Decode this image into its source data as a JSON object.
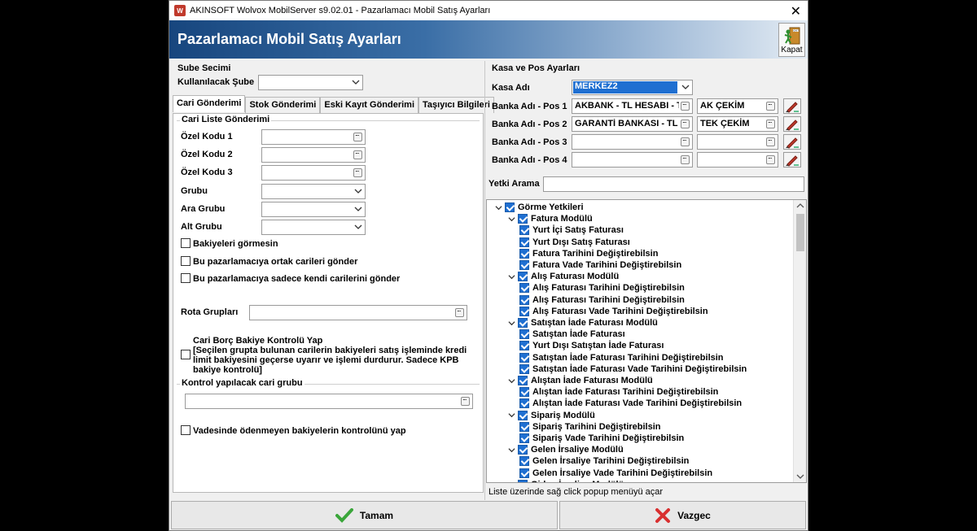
{
  "window": {
    "title": "AKINSOFT Wolvox MobilServer s9.02.01 - Pazarlamacı Mobil Satış Ayarları",
    "banner_title": "Pazarlamacı Mobil Satış Ayarları",
    "close_label": "Kapat",
    "app_icon_text": "W"
  },
  "branch": {
    "section_title": "Sube Secimi",
    "label": "Kullanılacak Şube",
    "value": ""
  },
  "tabs": [
    {
      "label": "Cari Gönderimi",
      "active": true
    },
    {
      "label": "Stok Gönderimi",
      "active": false
    },
    {
      "label": "Eski Kayıt Gönderimi",
      "active": false
    },
    {
      "label": "Taşıyıcı Bilgileri",
      "active": false
    }
  ],
  "cari": {
    "group_title": "Cari Liste Gönderimi",
    "fields": [
      {
        "label": "Özel Kodu 1",
        "value": ""
      },
      {
        "label": "Özel Kodu 2",
        "value": ""
      },
      {
        "label": "Özel Kodu 3",
        "value": ""
      },
      {
        "label": "Grubu",
        "value": ""
      },
      {
        "label": "Ara Grubu",
        "value": ""
      },
      {
        "label": "Alt Grubu",
        "value": ""
      }
    ],
    "checks": [
      {
        "label": "Bakiyeleri görmesin",
        "checked": false
      },
      {
        "label": "Bu pazarlamacıya ortak carileri gönder",
        "checked": false
      },
      {
        "label": "Bu pazarlamacıya sadece kendi carilerini gönder",
        "checked": false
      }
    ],
    "rota_label": "Rota Grupları",
    "rota_value": "",
    "borc_check_title": "Cari Borç Bakiye Kontrolü Yap",
    "borc_check_desc1": "[Seçilen grupta bulunan carilerin bakiyeleri satış işleminde kredi",
    "borc_check_desc2": "limit bakiyesini geçerse uyarır ve işlemi durdurur. Sadece KPB",
    "borc_check_desc3": "bakiye kontrolü]",
    "kontrol_group_title": "Kontrol yapılacak cari grubu",
    "kontrol_value": "",
    "vade_check": "Vadesinde ödenmeyen bakiyelerin kontrolünü yap"
  },
  "kasa": {
    "section_title": "Kasa ve Pos Ayarları",
    "kasa_label": "Kasa Adı",
    "kasa_value": "MERKEZ2",
    "pos": [
      {
        "label": "Banka Adı - Pos 1",
        "bank": "AKBANK - TL HESABI - T",
        "type": "AK ÇEKİM"
      },
      {
        "label": "Banka Adı - Pos 2",
        "bank": "GARANTİ BANKASI - TL",
        "type": "TEK ÇEKİM"
      },
      {
        "label": "Banka Adı - Pos 3",
        "bank": "",
        "type": ""
      },
      {
        "label": "Banka Adı - Pos 4",
        "bank": "",
        "type": ""
      }
    ],
    "yetki_label": "Yetki Arama",
    "yetki_value": ""
  },
  "tree": [
    {
      "level": 0,
      "label": "Görme Yetkileri",
      "expanded": true
    },
    {
      "level": 1,
      "label": "Fatura Modülü",
      "expanded": true
    },
    {
      "level": 2,
      "label": "Yurt İçi Satış Faturası"
    },
    {
      "level": 2,
      "label": "Yurt Dışı Satış Faturası"
    },
    {
      "level": 2,
      "label": "Fatura Tarihini Değiştirebilsin"
    },
    {
      "level": 2,
      "label": "Fatura Vade Tarihini Değiştirebilsin"
    },
    {
      "level": 1,
      "label": "Alış Faturası Modülü",
      "expanded": true
    },
    {
      "level": 2,
      "label": "Alış Faturası Tarihini Değiştirebilsin"
    },
    {
      "level": 2,
      "label": "Alış Faturası Tarihini Değiştirebilsin"
    },
    {
      "level": 2,
      "label": "Alış Faturası Vade Tarihini Değiştirebilsin"
    },
    {
      "level": 1,
      "label": "Satıştan İade Faturası Modülü",
      "expanded": true
    },
    {
      "level": 2,
      "label": "Satıştan İade Faturası"
    },
    {
      "level": 2,
      "label": "Yurt Dışı Satıştan İade Faturası"
    },
    {
      "level": 2,
      "label": "Satıştan İade Faturası Tarihini Değiştirebilsin"
    },
    {
      "level": 2,
      "label": "Satıştan İade Faturası Vade Tarihini Değiştirebilsin"
    },
    {
      "level": 1,
      "label": "Alıştan İade Faturası Modülü",
      "expanded": true
    },
    {
      "level": 2,
      "label": "Alıştan İade Faturası Tarihini Değiştirebilsin"
    },
    {
      "level": 2,
      "label": "Alıştan İade Faturası Vade Tarihini Değiştirebilsin"
    },
    {
      "level": 1,
      "label": "Sipariş Modülü",
      "expanded": true
    },
    {
      "level": 2,
      "label": "Sipariş Tarihini Değiştirebilsin"
    },
    {
      "level": 2,
      "label": "Sipariş Vade Tarihini Değiştirebilsin"
    },
    {
      "level": 1,
      "label": "Gelen İrsaliye Modülü",
      "expanded": true
    },
    {
      "level": 2,
      "label": "Gelen İrsaliye Tarihini Değiştirebilsin"
    },
    {
      "level": 2,
      "label": "Gelen İrsaliye Vade Tarihini Değiştirebilsin"
    },
    {
      "level": 1,
      "label": "Giden İrsaliye Modülü",
      "expanded": true
    }
  ],
  "status_hint": "Liste üzerinde sağ click popup menüyü açar",
  "footer": {
    "ok_label": "Tamam",
    "cancel_label": "Vazgec"
  },
  "colors": {
    "banner_dark": "#17467e",
    "selection": "#1f6fd1",
    "ok_green": "#3aa63a",
    "cancel_red": "#d93030"
  }
}
